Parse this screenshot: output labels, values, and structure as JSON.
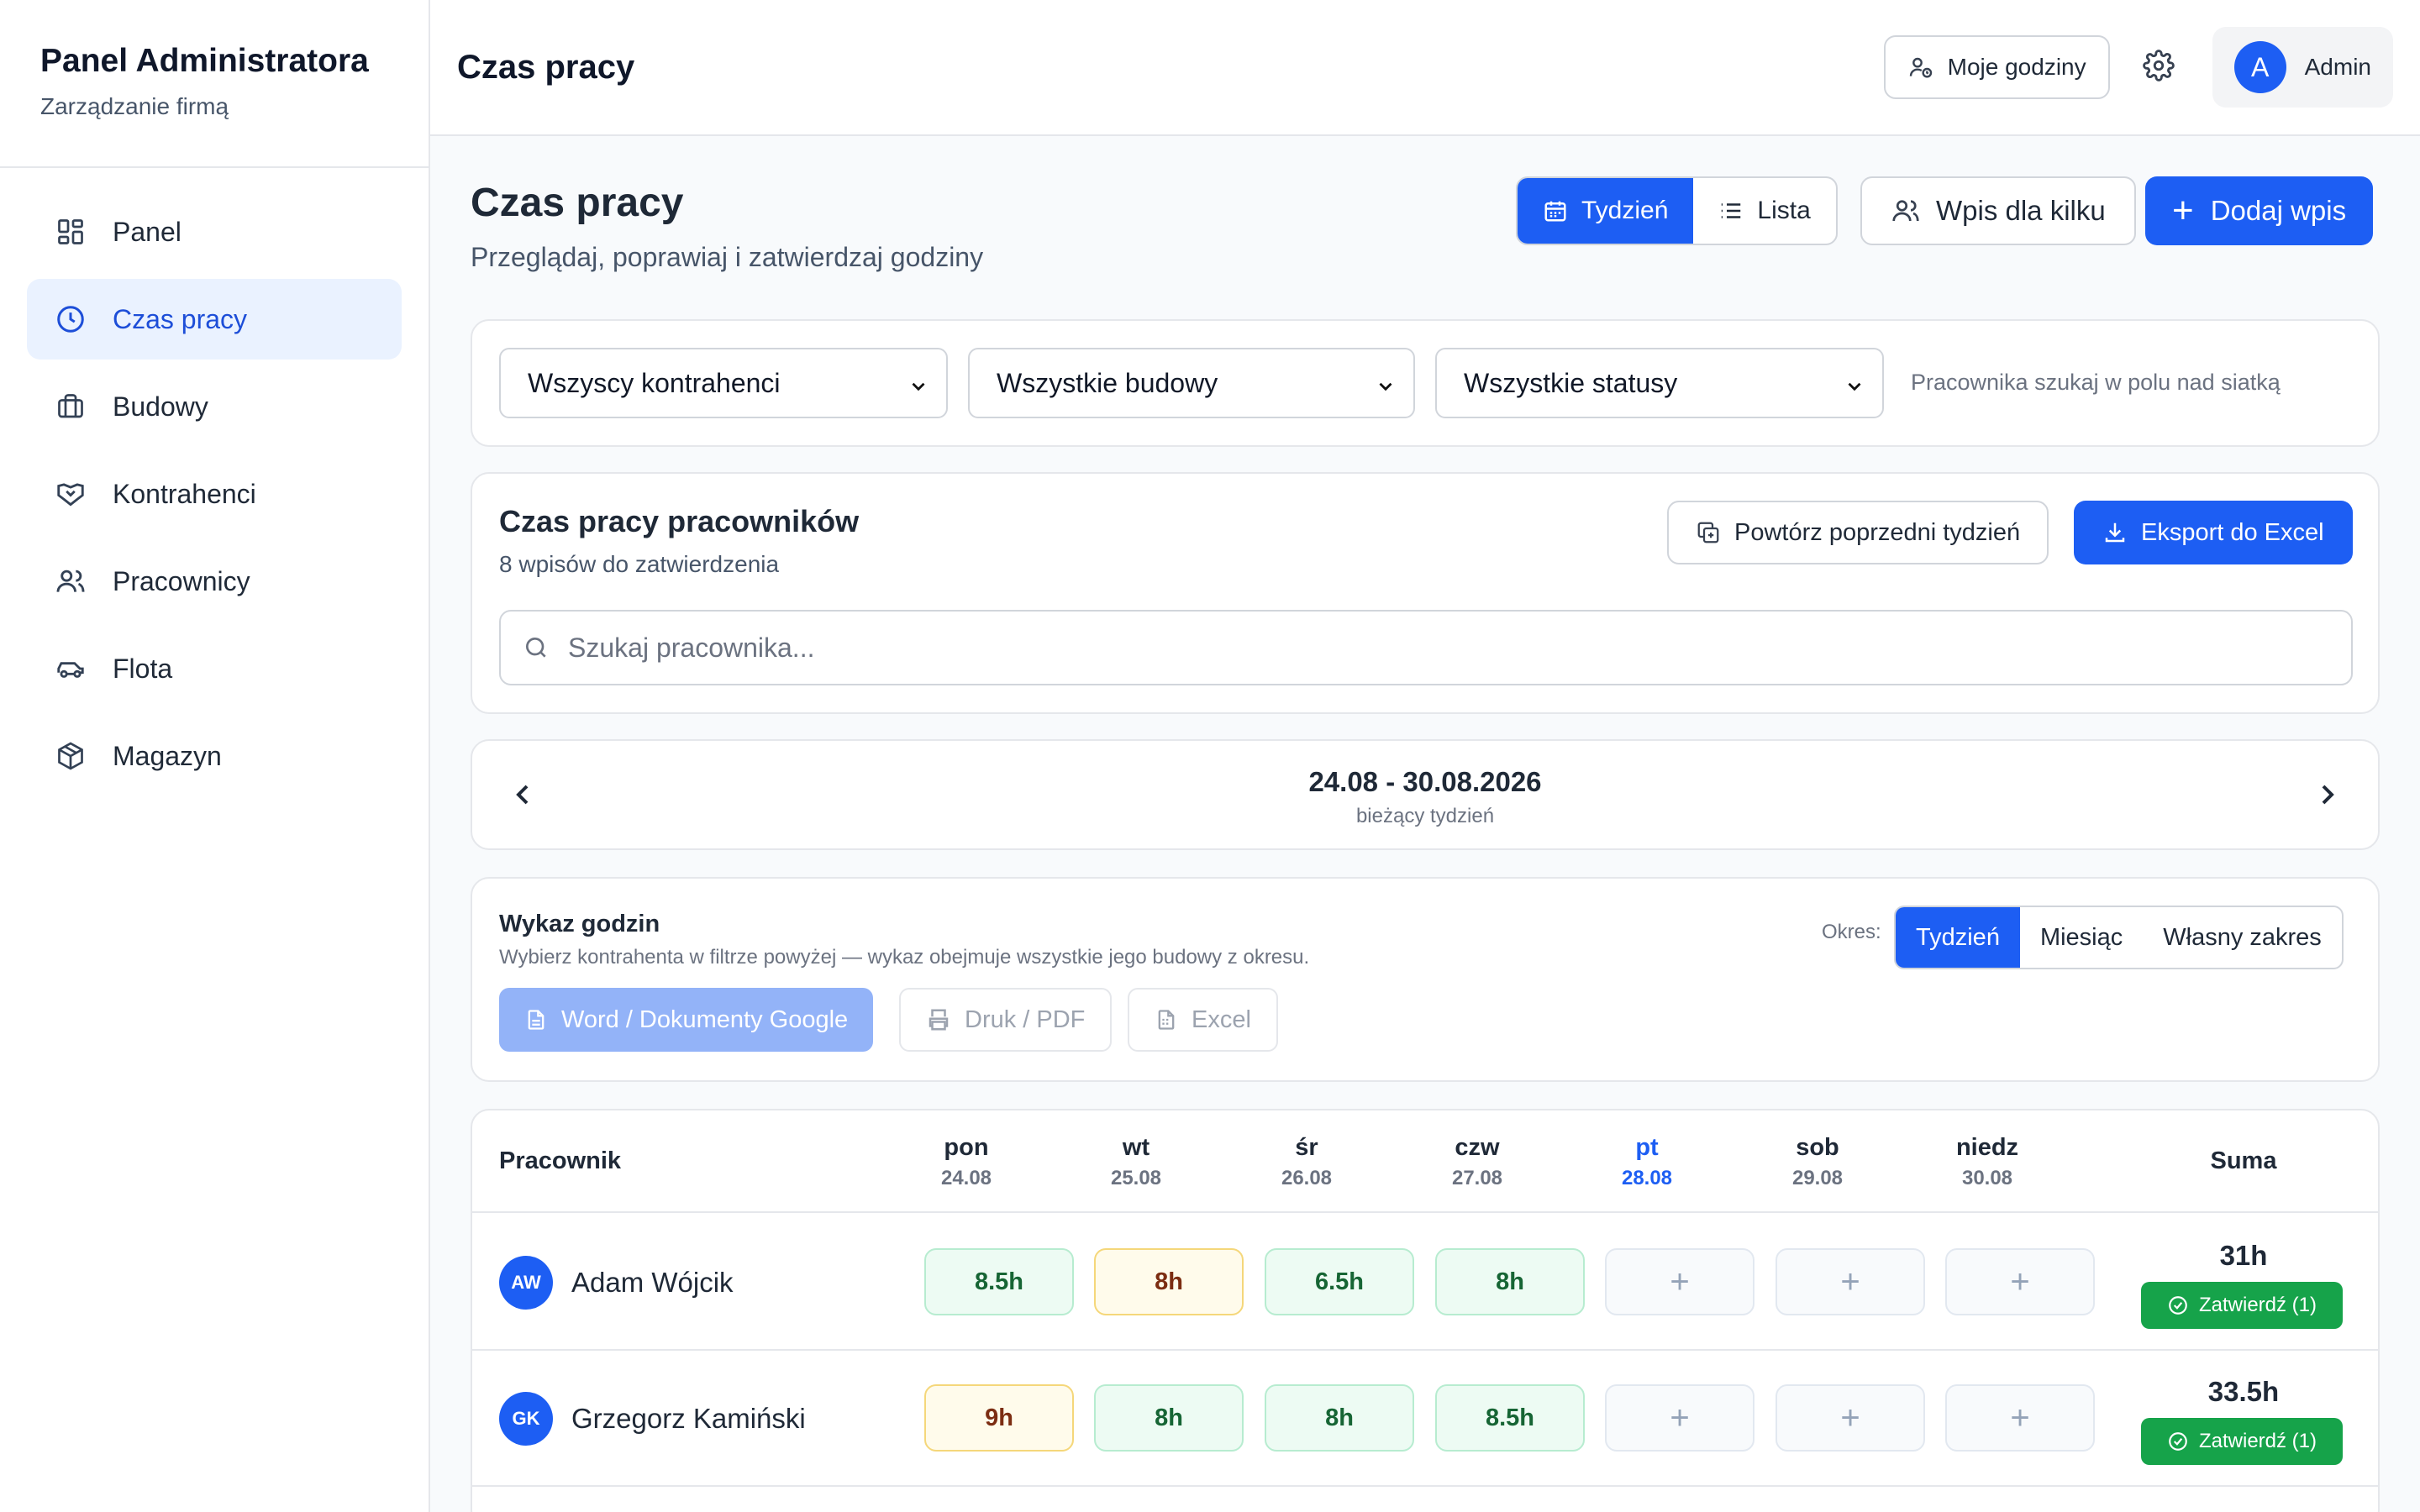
{
  "sidebar": {
    "title": "Panel Administratora",
    "subtitle": "Zarządzanie firmą",
    "items": [
      {
        "label": "Panel",
        "icon": "grid-icon"
      },
      {
        "label": "Czas pracy",
        "icon": "clock-icon",
        "active": true
      },
      {
        "label": "Budowy",
        "icon": "briefcase-icon"
      },
      {
        "label": "Kontrahenci",
        "icon": "handshake-icon"
      },
      {
        "label": "Pracownicy",
        "icon": "users-icon"
      },
      {
        "label": "Flota",
        "icon": "car-icon"
      },
      {
        "label": "Magazyn",
        "icon": "box-icon"
      }
    ]
  },
  "topbar": {
    "title": "Czas pracy",
    "my_hours": "Moje godziny",
    "avatar_letter": "A",
    "user": "Admin"
  },
  "page": {
    "title": "Czas pracy",
    "subtitle": "Przeglądaj, poprawiaj i zatwierdzaj godziny",
    "view_week": "Tydzień",
    "view_list": "Lista",
    "multi_entry": "Wpis dla kilku",
    "add_entry": "Dodaj wpis"
  },
  "filters": {
    "contractor": "Wszyscy kontrahenci",
    "site": "Wszystkie budowy",
    "status": "Wszystkie statusy",
    "hint": "Pracownika szukaj w polu nad siatką"
  },
  "employees": {
    "title": "Czas pracy pracowników",
    "subtitle": "8 wpisów do zatwierdzenia",
    "repeat": "Powtórz poprzedni tydzień",
    "export": "Eksport do Excel",
    "search_placeholder": "Szukaj pracownika..."
  },
  "week": {
    "range": "24.08 - 30.08.2026",
    "label": "bieżący tydzień"
  },
  "report": {
    "title": "Wykaz godzin",
    "subtitle": "Wybierz kontrahenta w filtrze powyżej — wykaz obejmuje wszystkie jego budowy z okresu.",
    "word": "Word / Dokumenty Google",
    "print": "Druk / PDF",
    "excel": "Excel",
    "period_label": "Okres:",
    "period_options": [
      "Tydzień",
      "Miesiąc",
      "Własny zakres"
    ],
    "period_selected": "Tydzień"
  },
  "grid": {
    "employee_header": "Pracownik",
    "sum_header": "Suma",
    "days": [
      {
        "name": "pon",
        "date": "24.08"
      },
      {
        "name": "wt",
        "date": "25.08"
      },
      {
        "name": "śr",
        "date": "26.08"
      },
      {
        "name": "czw",
        "date": "27.08"
      },
      {
        "name": "pt",
        "date": "28.08",
        "today": true
      },
      {
        "name": "sob",
        "date": "29.08"
      },
      {
        "name": "niedz",
        "date": "30.08"
      }
    ],
    "rows": [
      {
        "initials": "AW",
        "name": "Adam Wójcik",
        "cells": [
          {
            "value": "8.5h",
            "status": "approved"
          },
          {
            "value": "8h",
            "status": "pending"
          },
          {
            "value": "6.5h",
            "status": "approved"
          },
          {
            "value": "8h",
            "status": "approved"
          },
          {
            "value": "+",
            "status": "empty"
          },
          {
            "value": "+",
            "status": "empty"
          },
          {
            "value": "+",
            "status": "empty"
          }
        ],
        "total": "31h",
        "approve": "Zatwierdź (1)"
      },
      {
        "initials": "GK",
        "name": "Grzegorz Kamiński",
        "cells": [
          {
            "value": "9h",
            "status": "pending"
          },
          {
            "value": "8h",
            "status": "approved"
          },
          {
            "value": "8h",
            "status": "approved"
          },
          {
            "value": "8.5h",
            "status": "approved"
          },
          {
            "value": "+",
            "status": "empty"
          },
          {
            "value": "+",
            "status": "empty"
          },
          {
            "value": "+",
            "status": "empty"
          }
        ],
        "total": "33.5h",
        "approve": "Zatwierdź (1)"
      }
    ]
  },
  "colors": {
    "primary": "#1d5ef3",
    "approved_bg": "#edfbf3",
    "pending_bg": "#fffbeb",
    "approve_button": "#16a34a"
  }
}
